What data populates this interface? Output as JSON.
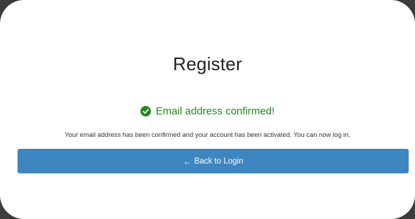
{
  "page": {
    "title": "Register"
  },
  "status": {
    "icon": "check-circle-icon",
    "text": "Email address confirmed!",
    "color": "#1f8a1f"
  },
  "message": {
    "text": "Your email address has been confirmed and your account has been activated. You can now log in."
  },
  "back_button": {
    "icon": "arrow-left-icon",
    "label": "Back to Login",
    "color": "#3d86c0"
  }
}
